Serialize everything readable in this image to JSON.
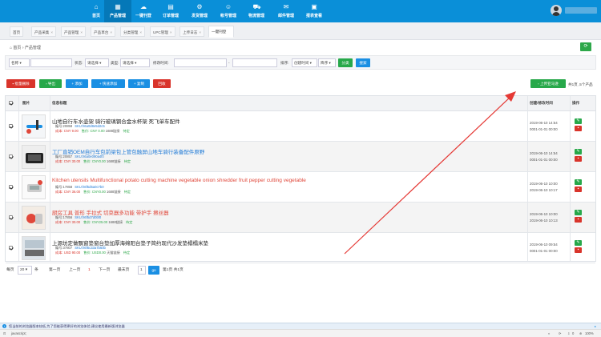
{
  "nav": {
    "items": [
      {
        "label": "首页",
        "icon": "home-icon"
      },
      {
        "label": "产品管理",
        "icon": "grid-icon"
      },
      {
        "label": "一键刊登",
        "icon": "cloud-upload-icon"
      },
      {
        "label": "订单管理",
        "icon": "list-icon"
      },
      {
        "label": "发货管理",
        "icon": "gear-icon"
      },
      {
        "label": "帐号管理",
        "icon": "user-icon"
      },
      {
        "label": "物流管理",
        "icon": "truck-icon"
      },
      {
        "label": "邮件管理",
        "icon": "mail-icon"
      },
      {
        "label": "报表查看",
        "icon": "report-icon"
      }
    ]
  },
  "tabs": [
    {
      "label": "首页"
    },
    {
      "label": "产品采集"
    },
    {
      "label": "产品管理"
    },
    {
      "label": "产品草台"
    },
    {
      "label": "分类管理"
    },
    {
      "label": "UPC管理"
    },
    {
      "label": "上传日志"
    },
    {
      "label": "一键刊登"
    }
  ],
  "breadcrumb": {
    "home": "首页",
    "sep": "›",
    "current": "产品管理"
  },
  "search": {
    "field_select": "名称",
    "status_label": "状态:",
    "status_value": "请选择",
    "type_label": "类型:",
    "type_value": "请选择",
    "modified_label": "修改时间:",
    "range_sep": "-",
    "sort_label": "排序:",
    "sort_field": "创建时间",
    "sort_dir": "降序",
    "group_button": "分类",
    "search_button": "搜索"
  },
  "toolbar": {
    "batch_delete": "批量删除",
    "export": "导出",
    "add": "+ 添加",
    "quick_add": "+ 快速添加",
    "copy": "+ 复制",
    "recycle": "回收",
    "upload_button": "上传亚马逊",
    "page_info": "共1页 ,5个产品"
  },
  "table": {
    "headers": {
      "image": "图片",
      "info": "信息标题",
      "time": "创建/修改时间",
      "action": "操作"
    },
    "rows": [
      {
        "title": "山地自行车水壶架 骑行玻璃钢合金水杯架 死飞单车配件",
        "sku_label": "编号:",
        "sku": "20858",
        "parent_sku": "SKU:h6a0d8e5d2c5",
        "cost": "成本: CNY 9.00",
        "sale": "售价: CNY 0.00",
        "stock": "1688链接",
        "tag": "待定",
        "created": "2019-06-10 14:54",
        "modified": "0001-01-01 00:00"
      },
      {
        "title": "工厂直销OEM自行车包前梁包上管包触屏山地车骑行装备配件原野",
        "sku_label": "编号:",
        "sku": "20857",
        "parent_sku": "SKU:h6a0e090a4f0",
        "cost": "成本: CNY 30.00",
        "sale": "售价: CNY0.00",
        "stock": "1688链接",
        "tag": "待定",
        "created": "2019-06-10 14:54",
        "modified": "0001-01-01 00:00"
      },
      {
        "title": "Kitchen utensils Multifunctional potato cutting machine vegetable onion shredder fruit pepper cutting vegetable",
        "sku_label": "编号:",
        "sku": "17858",
        "parent_sku": "SKU:h6f5d5a0c7b0",
        "cost": "成本: CNY 36.00",
        "sale": "售价: CNY0.00",
        "stock": "1688链接",
        "tag": "待定",
        "created": "2019-06-10 10:00",
        "modified": "2019-06-10 10:17"
      },
      {
        "title": "厨房工具 普形 手拉式 切菜器多功能 带护手 擦丝器",
        "sku_label": "编号:",
        "sku": "17856",
        "parent_sku": "SKU:h6f5d7d0bf0",
        "cost": "成本: CNY 30.00",
        "sale": "售价: CNY25.00",
        "stock": "1688链接",
        "tag": "待定",
        "created": "2019-06-10 10:00",
        "modified": "2019-06-10 10:13"
      },
      {
        "title": "上源坊定做飘窗垫窗台垫加厚海绵阳台垫子简约现代沙发垫榻榻米垫",
        "sku_label": "编号:",
        "sku": "37807",
        "parent_sku": "SKU:h6f6c33a7b60b",
        "cost": "成本: USD 90.00",
        "sale": "售价: USD0.00",
        "stock": "天猫链接",
        "tag": "待定",
        "created": "2019-06-10 09:54",
        "modified": "0001-01-01 00:00"
      }
    ]
  },
  "pager": {
    "per_page_label": "每页",
    "per_page": "20",
    "unit": "条",
    "first": "第一页",
    "prev": "上一页",
    "current": "1",
    "next": "下一页",
    "last": "最末页",
    "goto_value": "1",
    "go": "go",
    "summary": "第1页 共1页"
  },
  "status_bar": {
    "message": "您当前的浏览器版本较低,为了您能获得更好的浏览体验,建议使用最新版浏览器"
  },
  "browser_bar": {
    "url": "javascript;",
    "zoom": "100%",
    "downloads": "0"
  },
  "colors": {
    "nav": "#0a8fd8",
    "green": "#27a84a",
    "blue": "#1a8fe3",
    "red": "#d9342b",
    "arrow": "#e53935"
  }
}
